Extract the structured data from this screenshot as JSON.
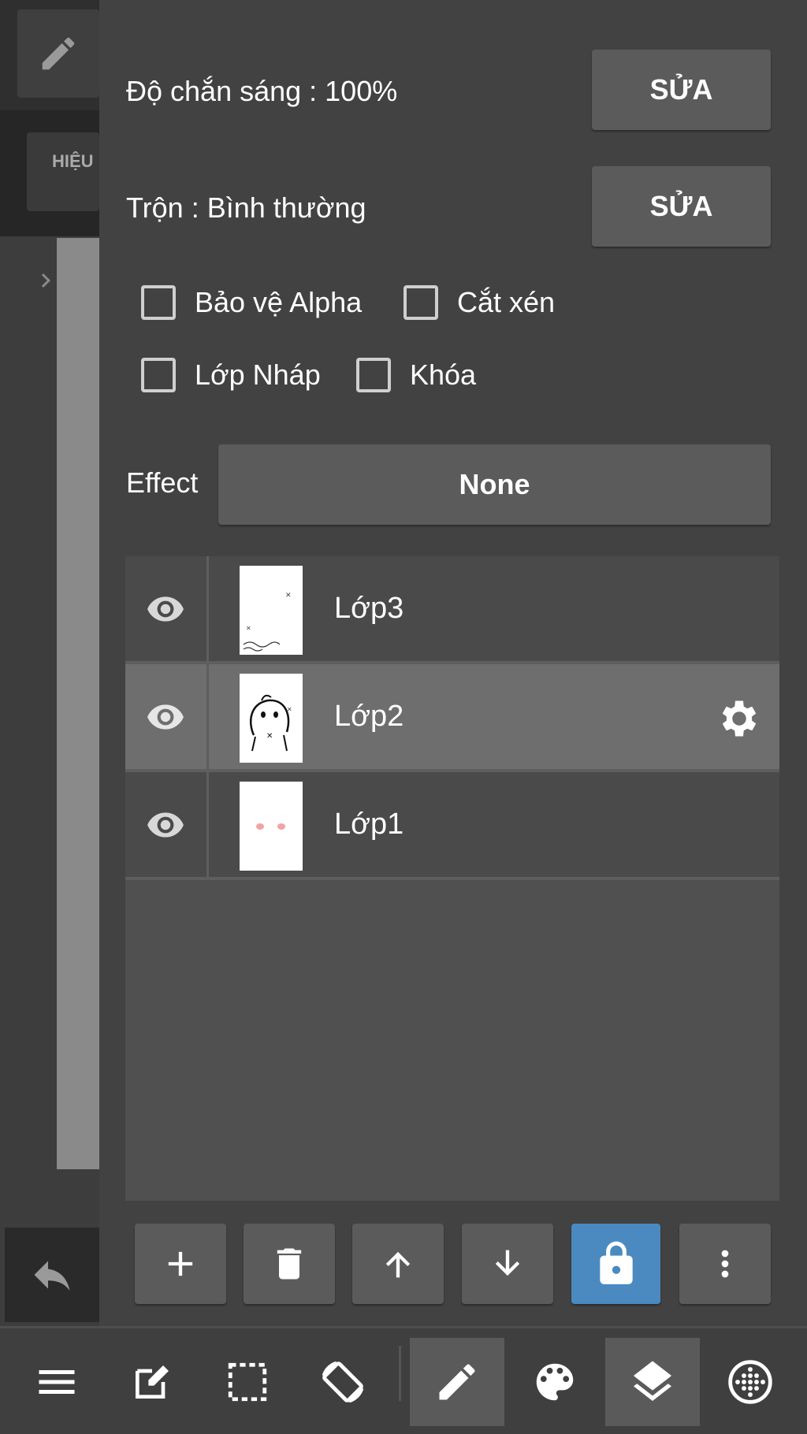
{
  "left_strip": {
    "tab_label": "HIỆU"
  },
  "opacity": {
    "label": "Độ chắn sáng : 100%",
    "button": "SỬA"
  },
  "blend": {
    "label": "Trộn : Bình thường",
    "button": "SỬA"
  },
  "checkboxes": {
    "alpha_protect": "Bảo vệ Alpha",
    "clipping": "Cắt xén",
    "draft_layer": "Lớp Nháp",
    "lock": "Khóa"
  },
  "effect": {
    "label": "Effect",
    "value": "None"
  },
  "layers": [
    {
      "name": "Lớp3",
      "selected": false
    },
    {
      "name": "Lớp2",
      "selected": true
    },
    {
      "name": "Lớp1",
      "selected": false
    }
  ],
  "layer_actions": [
    "plus-icon",
    "trash-icon",
    "arrow-up-icon",
    "arrow-down-icon",
    "lock-icon",
    "more-vertical-icon"
  ],
  "toolbar": [
    "menu-icon",
    "edit-icon",
    "selection-icon",
    "rotate-icon",
    "pen-icon",
    "palette-icon",
    "layers-icon",
    "grid-icon"
  ],
  "colors": {
    "panel": "#424242",
    "button": "#5b5b5b",
    "accent": "#4a8ac0",
    "selected_layer": "#6e6e6e"
  }
}
